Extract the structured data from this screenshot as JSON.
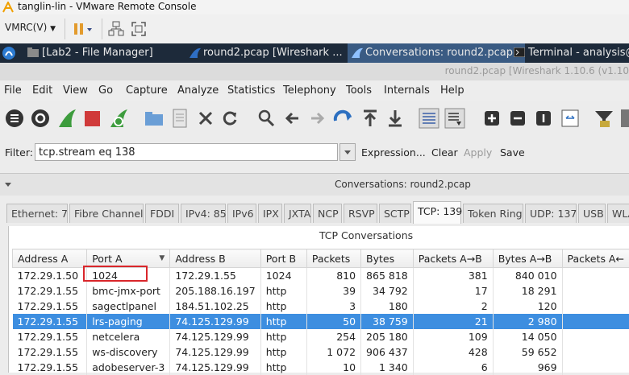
{
  "window": {
    "title": "tanglin-lin - VMware Remote Console"
  },
  "vmrc": {
    "menu_label": "VMRC(V)"
  },
  "taskbar": {
    "items": [
      {
        "label": "[Lab2 - File Manager]"
      },
      {
        "label": "round2.pcap   [Wireshark ..."
      },
      {
        "label": "Conversations: round2.pcap"
      },
      {
        "label": "Terminal - analysis@a"
      }
    ]
  },
  "wireshark": {
    "window_title": "round2.pcap   [Wireshark 1.10.6  (v1.10"
  },
  "menubar": {
    "items": [
      "File",
      "Edit",
      "View",
      "Go",
      "Capture",
      "Analyze",
      "Statistics",
      "Telephony",
      "Tools",
      "Internals",
      "Help"
    ]
  },
  "filter": {
    "label": "Filter:",
    "value": "tcp.stream eq 138",
    "expression": "Expression...",
    "clear": "Clear",
    "apply": "Apply",
    "save": "Save"
  },
  "dialog": {
    "title": "Conversations: round2.pcap"
  },
  "tabs": [
    "Ethernet: 7",
    "Fibre Channel",
    "FDDI",
    "IPv4: 85",
    "IPv6",
    "IPX",
    "JXTA",
    "NCP",
    "RSVP",
    "SCTP",
    "TCP: 139",
    "Token Ring",
    "UDP: 137",
    "USB",
    "WLA"
  ],
  "selected_tab": "TCP: 139",
  "table": {
    "title": "TCP Conversations",
    "columns": [
      "Address A",
      "Port A",
      "Address B",
      "Port B",
      "Packets",
      "Bytes",
      "Packets A→B",
      "Bytes A→B",
      "Packets A←"
    ],
    "rows": [
      [
        "172.29.1.50",
        "1024",
        "172.29.1.55",
        "1024",
        "810",
        "865 818",
        "381",
        "840 010",
        ""
      ],
      [
        "172.29.1.55",
        "bmc-jmx-port",
        "205.188.16.197",
        "http",
        "39",
        "34 792",
        "17",
        "18 291",
        ""
      ],
      [
        "172.29.1.55",
        "sagectlpanel",
        "184.51.102.25",
        "http",
        "3",
        "180",
        "2",
        "120",
        ""
      ],
      [
        "172.29.1.55",
        "lrs-paging",
        "74.125.129.99",
        "http",
        "50",
        "38 759",
        "21",
        "2 980",
        ""
      ],
      [
        "172.29.1.55",
        "netcelera",
        "74.125.129.99",
        "http",
        "254",
        "205 180",
        "109",
        "14 050",
        ""
      ],
      [
        "172.29.1.55",
        "ws-discovery",
        "74.125.129.99",
        "http",
        "1 072",
        "906 437",
        "428",
        "59 652",
        ""
      ],
      [
        "172.29.1.55",
        "adobeserver-3",
        "74.125.129.99",
        "http",
        "10",
        "1 340",
        "6",
        "969",
        ""
      ]
    ],
    "selected_row": 3
  },
  "colors": {
    "taskbar_bg": "#1d2a3a",
    "selection": "#3d8ee0",
    "highlight_box": "#d9262b",
    "shark_fin": "#3d9c3d",
    "stop": "#d03a3a"
  }
}
